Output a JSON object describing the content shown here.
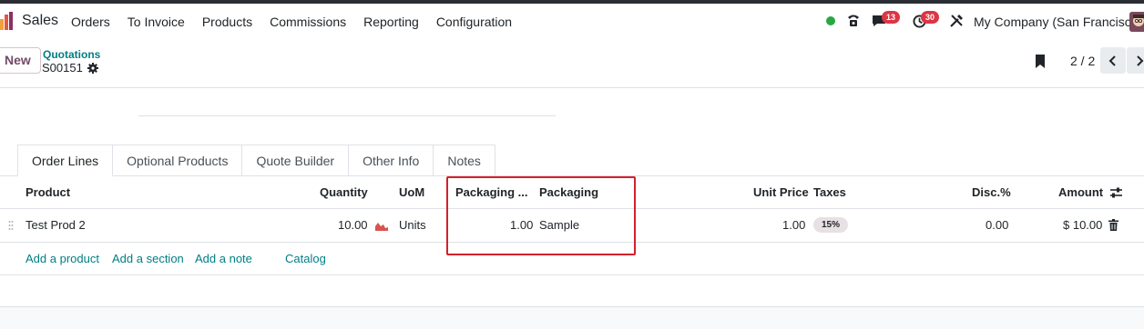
{
  "navbar": {
    "app_name": "Sales",
    "menu": [
      "Orders",
      "To Invoice",
      "Products",
      "Commissions",
      "Reporting",
      "Configuration"
    ],
    "messages_badge": "13",
    "activities_badge": "30",
    "company": "My Company (San Francisco)"
  },
  "control": {
    "new_label": "New",
    "breadcrumb": "Quotations",
    "record_name": "S00151",
    "pager": "2 / 2"
  },
  "tabs": [
    "Order Lines",
    "Optional Products",
    "Quote Builder",
    "Other Info",
    "Notes"
  ],
  "table": {
    "headers": {
      "product": "Product",
      "quantity": "Quantity",
      "uom": "UoM",
      "packaging_qty": "Packaging ...",
      "packaging": "Packaging",
      "unit_price": "Unit Price",
      "taxes": "Taxes",
      "disc": "Disc.%",
      "amount": "Amount"
    },
    "rows": [
      {
        "product": "Test Prod 2",
        "quantity": "10.00",
        "uom": "Units",
        "packaging_qty": "1.00",
        "packaging": "Sample",
        "unit_price": "1.00",
        "taxes": "15%",
        "disc": "0.00",
        "amount": "$ 10.00"
      }
    ],
    "add_links": {
      "product": "Add a product",
      "section": "Add a section",
      "note": "Add a note",
      "catalog": "Catalog"
    }
  },
  "colors": {
    "accent_teal": "#017e84",
    "brand_purple": "#714b67",
    "highlight_red": "#d4202c",
    "status_green": "#28a745",
    "badge_red": "#dc3545"
  }
}
